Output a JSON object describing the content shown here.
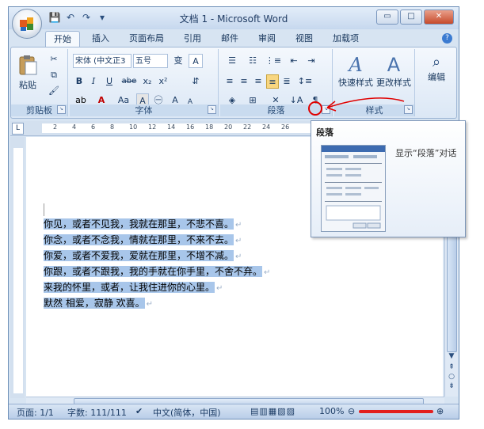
{
  "window": {
    "title": "文档 1 - Microsoft Word"
  },
  "window_buttons": {
    "minimize": "▭",
    "maximize": "□",
    "close": "✕"
  },
  "tabs": [
    {
      "label": "开始",
      "active": true
    },
    {
      "label": "插入"
    },
    {
      "label": "页面布局"
    },
    {
      "label": "引用"
    },
    {
      "label": "邮件"
    },
    {
      "label": "审阅"
    },
    {
      "label": "视图"
    },
    {
      "label": "加载项"
    }
  ],
  "ribbon": {
    "clipboard": {
      "label": "剪贴板",
      "paste_label": "粘贴"
    },
    "font": {
      "label": "字体",
      "font_name": "宋体 (中文正3",
      "font_size": "五号",
      "bold": "B",
      "italic": "I",
      "underline": "U",
      "strike": "abe",
      "sub": "x₂",
      "sup": "x²",
      "aa": "Aa",
      "grow": "A",
      "shrink": "A"
    },
    "paragraph": {
      "label": "段落"
    },
    "styles": {
      "label": "样式",
      "quick_style": "快速样式",
      "change_style": "更改样式"
    },
    "editing": {
      "label": "编辑"
    }
  },
  "ruler": {
    "h_numbers": [
      "2",
      "4",
      "6",
      "8",
      "10",
      "12",
      "14",
      "16",
      "18",
      "20",
      "22",
      "24",
      "26"
    ]
  },
  "document": {
    "lines": [
      "你见，或者不见我，我就在那里，不悲不喜。",
      "你念，或者不念我，情就在那里，不来不去。",
      "你爱，或者不爱我，爱就在那里，不增不减。",
      "你跟，或者不跟我，我的手就在你手里，不舍不弃。",
      "来我的怀里，或者，让我住进你的心里。",
      "默然  相爱，寂静  欢喜。"
    ],
    "para_mark": "↵"
  },
  "tooltip": {
    "title": "段落",
    "text": "显示“段落”对话"
  },
  "status": {
    "page": "页面: 1/1",
    "words": "字数: 111/111",
    "lang": "中文(简体，中国)",
    "zoom": "100%"
  },
  "colors": {
    "selection": "#a8c6ea",
    "annotation": "#e00000"
  }
}
